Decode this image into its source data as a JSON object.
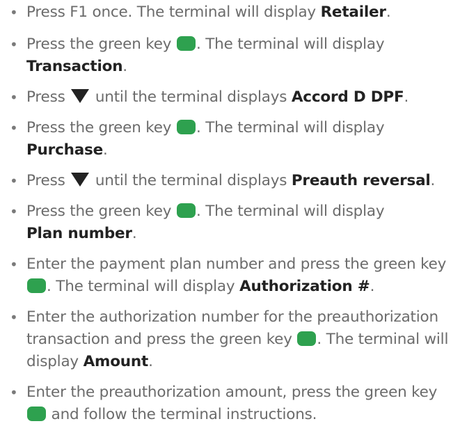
{
  "colors": {
    "text": "#6b6b6b",
    "emphasis": "#222222",
    "green_key": "#2ea14f"
  },
  "bullet": "•",
  "steps": [
    {
      "a": "Press F1 once. The terminal will display ",
      "b": "Retailer",
      "c": "."
    },
    {
      "a": "Press the green key ",
      "b": ". The terminal will display",
      "c": "Transaction",
      "d": "."
    },
    {
      "a": "Press ",
      "b": " until the terminal displays ",
      "c": "Accord D DPF",
      "d": "."
    },
    {
      "a": "Press the green key ",
      "b": ". The terminal will display",
      "c": "Purchase",
      "d": "."
    },
    {
      "a": "Press ",
      "b": " until the terminal displays ",
      "c": "Preauth reversal",
      "d": "."
    },
    {
      "a": "Press the green key ",
      "b": ". The terminal will display",
      "c": "Plan number",
      "d": "."
    },
    {
      "a": "Enter the payment plan number and press the green key",
      "b": ". The terminal will display ",
      "c": "Authorization #",
      "d": "."
    },
    {
      "a": "Enter the authorization number for the preauthorization transaction and press the green key ",
      "b": ". The terminal will display ",
      "c": "Amount",
      "d": "."
    },
    {
      "a": "Enter the preauthorization amount, press the green key ",
      "b": " and follow the terminal instructions."
    }
  ]
}
